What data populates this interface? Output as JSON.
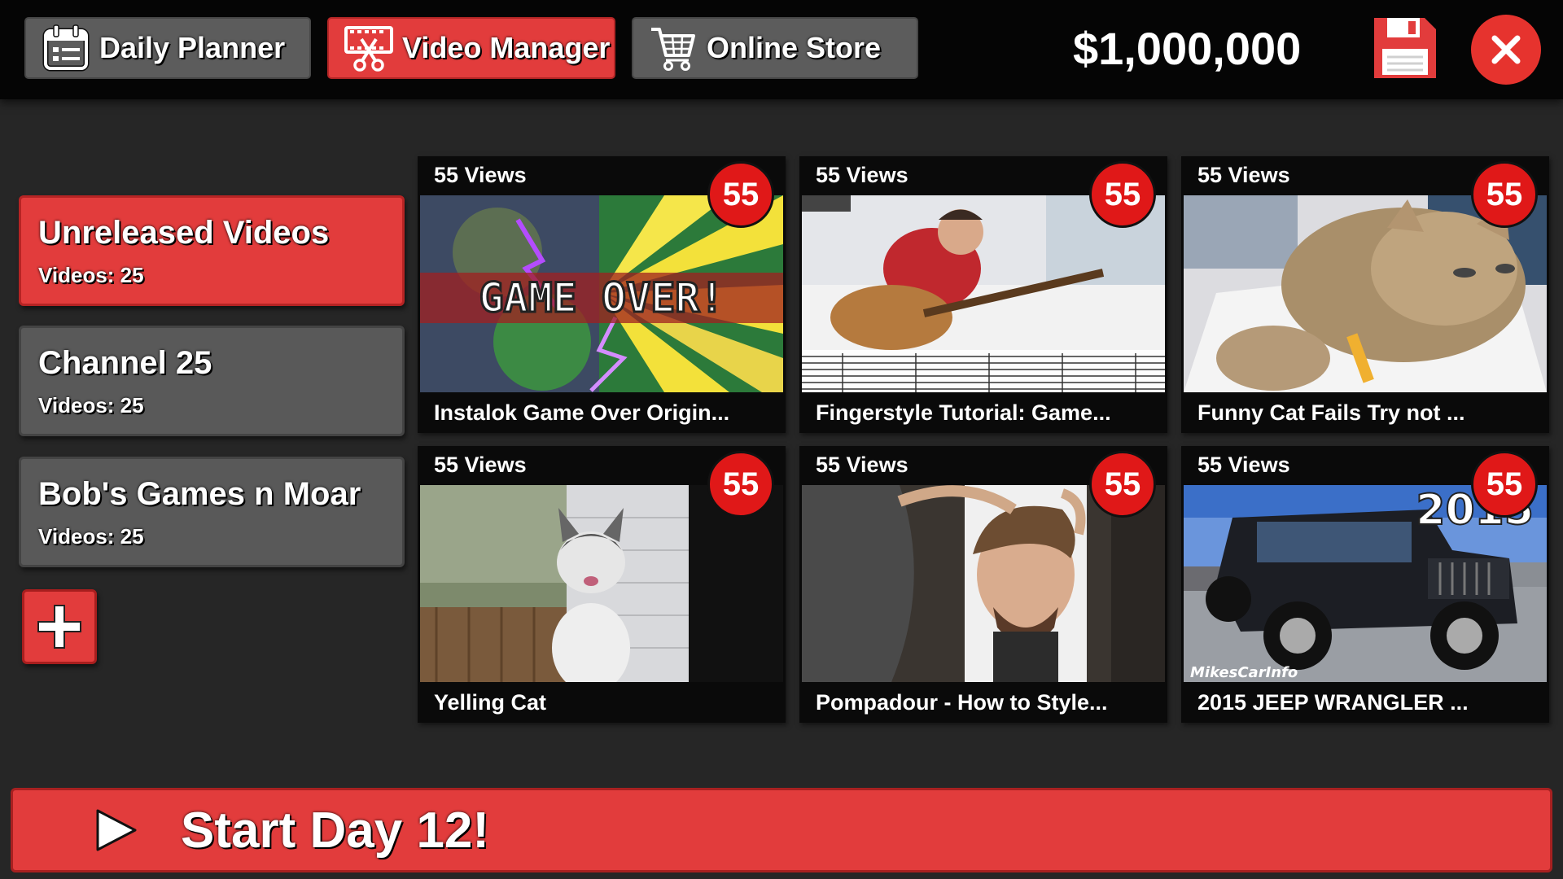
{
  "topbar": {
    "tabs": [
      {
        "label": "Daily Planner",
        "icon": "calendar-icon",
        "active": false
      },
      {
        "label": "Video Manager",
        "icon": "film-scissors-icon",
        "active": true
      },
      {
        "label": "Online Store",
        "icon": "shopping-cart-icon",
        "active": false
      }
    ],
    "money": "$1,000,000",
    "save_icon": "floppy-disk-icon",
    "close_icon": "close-icon"
  },
  "sidebar": {
    "channels": [
      {
        "name": "Unreleased Videos",
        "count": "Videos: 25",
        "selected": true
      },
      {
        "name": "Channel 25",
        "count": "Videos: 25",
        "selected": false
      },
      {
        "name": "Bob's Games n Moar",
        "count": "Videos: 25",
        "selected": false
      }
    ],
    "add_icon": "plus-icon"
  },
  "videos": [
    {
      "views": "55 Views",
      "badge": "55",
      "title": "Instalok Game Over Origin...",
      "thumb": "game-over-art",
      "thumb_text": "GAME OVER!"
    },
    {
      "views": "55 Views",
      "badge": "55",
      "title": "Fingerstyle Tutorial: Game...",
      "thumb": "guitar-player"
    },
    {
      "views": "55 Views",
      "badge": "55",
      "title": "Funny Cat Fails Try not ...",
      "thumb": "tabby-cat"
    },
    {
      "views": "55 Views",
      "badge": "55",
      "title": "Yelling Cat",
      "thumb": "yelling-cat"
    },
    {
      "views": "55 Views",
      "badge": "55",
      "title": "Pompadour - How to Style...",
      "thumb": "hair-styling"
    },
    {
      "views": "55 Views",
      "badge": "55",
      "title": "2015 JEEP WRANGLER ...",
      "thumb": "jeep-wrangler",
      "thumb_text": "2015",
      "watermark": "MikesCarInfo"
    }
  ],
  "start_button": {
    "label": "Start Day 12!",
    "icon": "play-icon"
  },
  "colors": {
    "accent_red": "#e23c3c",
    "tab_gray": "#5c5c5c",
    "badge_red": "#e01818",
    "background": "#262626",
    "topbar": "#050505"
  }
}
